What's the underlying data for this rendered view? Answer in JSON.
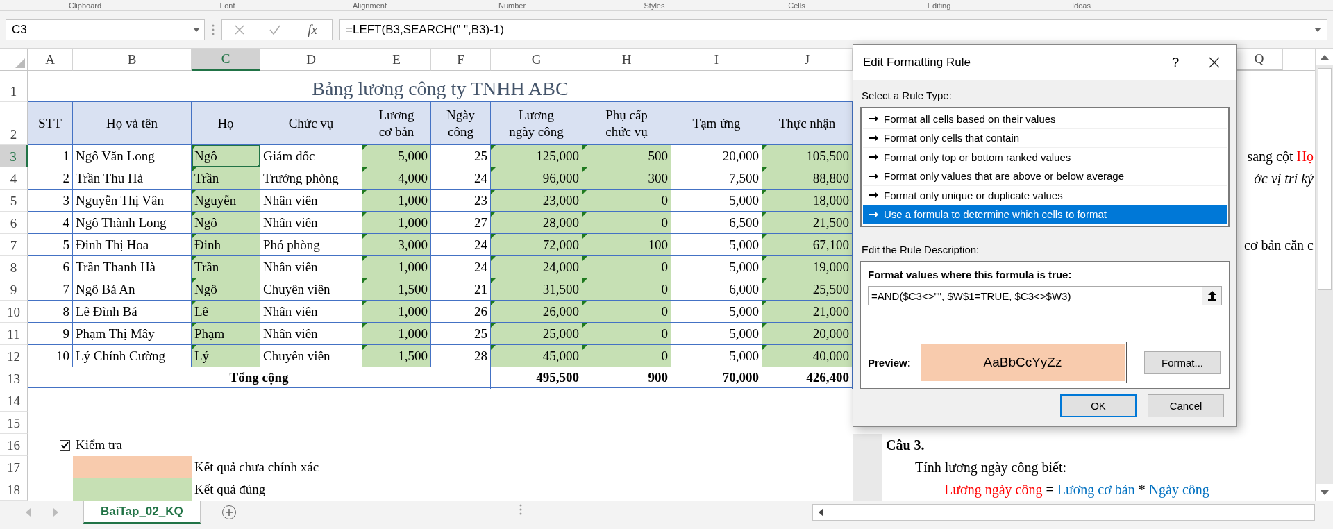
{
  "ribbon_groups": [
    "Clipboard",
    "Font",
    "Alignment",
    "Number",
    "Styles",
    "Cells",
    "Editing",
    "Ideas"
  ],
  "formula_bar": {
    "name_box": "C3",
    "function_label": "fx",
    "formula": "=LEFT(B3,SEARCH(\" \",B3)-1)"
  },
  "columns": [
    {
      "letter": "A",
      "selected": false,
      "marked": false
    },
    {
      "letter": "B",
      "selected": false,
      "marked": false
    },
    {
      "letter": "C",
      "selected": true,
      "marked": true
    },
    {
      "letter": "D",
      "selected": false,
      "marked": false
    },
    {
      "letter": "E",
      "selected": false,
      "marked": true
    },
    {
      "letter": "F",
      "selected": false,
      "marked": false
    },
    {
      "letter": "G",
      "selected": false,
      "marked": true
    },
    {
      "letter": "H",
      "selected": false,
      "marked": true
    },
    {
      "letter": "I",
      "selected": false,
      "marked": false
    },
    {
      "letter": "J",
      "selected": false,
      "marked": true
    }
  ],
  "right_column": "Q",
  "rows": [
    {
      "number": "1",
      "kind": "title",
      "selected": false,
      "text": "Bảng lương công ty TNHH ABC"
    },
    {
      "number": "2",
      "kind": "header",
      "selected": false,
      "cells": [
        "STT",
        "Họ và tên",
        "Họ",
        "Chức vụ",
        "Lương\ncơ bản",
        "Ngày\ncông",
        "Lương\nngày công",
        "Phụ cấp\nchức vụ",
        "Tạm ứng",
        "Thực nhận"
      ]
    },
    {
      "number": "3",
      "kind": "data",
      "selected": true,
      "cells": [
        "1",
        "Ngô Văn Long",
        "Ngô",
        "Giám đốc",
        "5,000",
        "25",
        "125,000",
        "500",
        "20,000",
        "105,500"
      ],
      "side_text": [
        {
          "text": "sang cột ",
          "kind": "plain"
        },
        {
          "text": "Họ",
          "kind": "result"
        }
      ]
    },
    {
      "number": "4",
      "kind": "data",
      "selected": false,
      "cells": [
        "2",
        "Trần Thu Hà",
        "Trần",
        "Trưởng phòng",
        "4,000",
        "24",
        "96,000",
        "300",
        "7,500",
        "88,800"
      ],
      "side_text": [
        {
          "text": "ớc vị trí ký",
          "kind": "italic"
        }
      ]
    },
    {
      "number": "5",
      "kind": "data",
      "selected": false,
      "cells": [
        "3",
        "Nguyễn Thị Vân",
        "Nguyễn",
        "Nhân viên",
        "1,000",
        "23",
        "23,000",
        "0",
        "5,000",
        "18,000"
      ]
    },
    {
      "number": "6",
      "kind": "data",
      "selected": false,
      "cells": [
        "4",
        "Ngô Thành Long",
        "Ngô",
        "Nhân viên",
        "1,000",
        "27",
        "28,000",
        "0",
        "6,500",
        "21,500"
      ]
    },
    {
      "number": "7",
      "kind": "data",
      "selected": false,
      "cells": [
        "5",
        "Đinh Thị Hoa",
        "Đinh",
        "Phó phòng",
        "3,000",
        "24",
        "72,000",
        "100",
        "5,000",
        "67,100"
      ],
      "side_text": [
        {
          "text": "cơ bản căn c",
          "kind": "plain"
        }
      ]
    },
    {
      "number": "8",
      "kind": "data",
      "selected": false,
      "cells": [
        "6",
        "Trần Thanh Hà",
        "Trần",
        "Nhân viên",
        "1,000",
        "24",
        "24,000",
        "0",
        "5,000",
        "19,000"
      ]
    },
    {
      "number": "9",
      "kind": "data",
      "selected": false,
      "cells": [
        "7",
        "Ngô Bá An",
        "Ngô",
        "Chuyên viên",
        "1,500",
        "21",
        "31,500",
        "0",
        "6,000",
        "25,500"
      ]
    },
    {
      "number": "10",
      "kind": "data",
      "selected": false,
      "cells": [
        "8",
        "Lê Đình Bá",
        "Lê",
        "Nhân viên",
        "1,000",
        "26",
        "26,000",
        "0",
        "5,000",
        "21,000"
      ]
    },
    {
      "number": "11",
      "kind": "data",
      "selected": false,
      "cells": [
        "9",
        "Phạm Thị Mây",
        "Phạm",
        "Nhân viên",
        "1,000",
        "25",
        "25,000",
        "0",
        "5,000",
        "20,000"
      ]
    },
    {
      "number": "12",
      "kind": "data",
      "selected": false,
      "cells": [
        "10",
        "Lý Chính Cường",
        "Lý",
        "Chuyên viên",
        "1,500",
        "28",
        "45,000",
        "0",
        "5,000",
        "40,000"
      ]
    },
    {
      "number": "13",
      "kind": "total",
      "selected": false,
      "label": "Tổng cộng",
      "cells": [
        "495,500",
        "900",
        "70,000",
        "426,400"
      ]
    },
    {
      "number": "14",
      "kind": "blank",
      "selected": false
    },
    {
      "number": "15",
      "kind": "blank",
      "selected": false
    },
    {
      "number": "16",
      "kind": "check",
      "selected": false,
      "checked": true,
      "caption": "Kiểm tra",
      "side_text": [
        {
          "text": "Câu 3.",
          "kind": "heading"
        }
      ]
    },
    {
      "number": "17",
      "kind": "legend",
      "selected": false,
      "color": "#f8cbad",
      "label": "Kết quả chưa chính xác",
      "side_text": [
        {
          "text": "Tính lương ngày công biết:",
          "kind": "plain"
        }
      ]
    },
    {
      "number": "18",
      "kind": "legend",
      "selected": false,
      "color": "#c6e0b4",
      "label": "Kết quả đúng",
      "side_text": [
        {
          "text": "Lương ngày công",
          "kind": "result"
        },
        {
          "text": " = ",
          "kind": "plain"
        },
        {
          "text": "Lương cơ bản",
          "kind": "input"
        },
        {
          "text": " * ",
          "kind": "plain"
        },
        {
          "text": "Ngày công",
          "kind": "input"
        }
      ]
    }
  ],
  "sheet_tabs": [
    {
      "label": "BaiTap_02_KQ",
      "selected": true
    }
  ],
  "dialog": {
    "title": "Edit Formatting Rule",
    "help": "?",
    "rule_type_label": "Select a Rule Type:",
    "rule_types": [
      {
        "label": "Format all cells based on their values",
        "selected": false
      },
      {
        "label": "Format only cells that contain",
        "selected": false
      },
      {
        "label": "Format only top or bottom ranked values",
        "selected": false
      },
      {
        "label": "Format only values that are above or below average",
        "selected": false
      },
      {
        "label": "Format only unique or duplicate values",
        "selected": false
      },
      {
        "label": "Use a formula to determine which cells to format",
        "selected": true
      }
    ],
    "description_label": "Edit the Rule Description:",
    "formula_label": "Format values where this formula is true:",
    "formula": "=AND($C3<>\"\", $W$1=TRUE, $C3<>$W3)",
    "preview_label": "Preview:",
    "preview_sample": "AaBbCcYyZz",
    "format_button": "Format...",
    "buttons": [
      {
        "label": "OK",
        "default": true
      },
      {
        "label": "Cancel",
        "default": false
      }
    ]
  }
}
